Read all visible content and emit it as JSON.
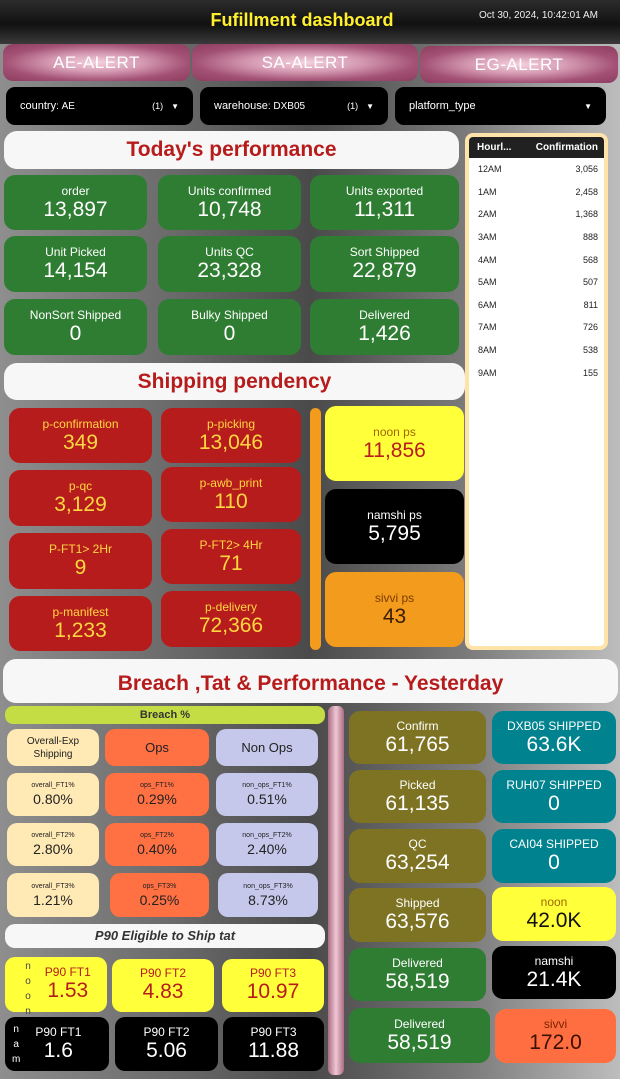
{
  "header": {
    "title": "Fufillment dashboard",
    "timestamp": "Oct 30, 2024, 10:42:01 AM"
  },
  "alerts": [
    "AE-ALERT",
    "SA-ALERT",
    "EG-ALERT"
  ],
  "filters": [
    {
      "key": "country",
      "value": "AE",
      "count": "(1)"
    },
    {
      "key": "warehouse",
      "value": "DXB05",
      "count": "(1)"
    },
    {
      "key": "platform_type",
      "value": "",
      "count": ""
    }
  ],
  "sections": {
    "today": "Today's performance",
    "shipping": "Shipping pendency",
    "breach": "Breach ,Tat & Performance - Yesterday"
  },
  "today": [
    {
      "label": "order",
      "value": "13,897"
    },
    {
      "label": "Units confirmed",
      "value": "10,748"
    },
    {
      "label": "Units exported",
      "value": "11,311"
    },
    {
      "label": "Unit Picked",
      "value": "14,154"
    },
    {
      "label": "Units QC",
      "value": "23,328"
    },
    {
      "label": "Sort Shipped",
      "value": "22,879"
    },
    {
      "label": "NonSort Shipped",
      "value": "0"
    },
    {
      "label": "Bulky Shipped",
      "value": "0"
    },
    {
      "label": "Delivered",
      "value": "1,426"
    }
  ],
  "pendency": [
    {
      "label": "p-confirmation",
      "value": "349"
    },
    {
      "label": "p-picking",
      "value": "13,046"
    },
    {
      "label": "p-qc",
      "value": "3,129"
    },
    {
      "label": "p-awb_print",
      "value": "110"
    },
    {
      "label": "P-FT1> 2Hr",
      "value": "9"
    },
    {
      "label": "P-FT2> 4Hr",
      "value": "71"
    },
    {
      "label": "p-manifest",
      "value": "1,233"
    },
    {
      "label": "p-delivery",
      "value": "72,366"
    }
  ],
  "platform_ps": [
    {
      "label": "noon ps",
      "value": "11,856"
    },
    {
      "label": "namshi ps",
      "value": "5,795"
    },
    {
      "label": "sivvi ps",
      "value": "43"
    }
  ],
  "hourly": {
    "headers": [
      "Hourl...",
      "Confirmation"
    ],
    "rows": [
      [
        "12AM",
        "3,056"
      ],
      [
        "1AM",
        "2,458"
      ],
      [
        "2AM",
        "1,368"
      ],
      [
        "3AM",
        "888"
      ],
      [
        "4AM",
        "568"
      ],
      [
        "5AM",
        "507"
      ],
      [
        "6AM",
        "811"
      ],
      [
        "7AM",
        "726"
      ],
      [
        "8AM",
        "538"
      ],
      [
        "9AM",
        "155"
      ]
    ]
  },
  "breach": {
    "title": "Breach %",
    "headers": [
      "Overall-Exp Shipping",
      "Ops",
      "Non Ops"
    ],
    "rows": [
      [
        {
          "label": "overall_FT1%",
          "value": "0.80%"
        },
        {
          "label": "ops_FT1%",
          "value": "0.29%"
        },
        {
          "label": "non_ops_FT1%",
          "value": "0.51%"
        }
      ],
      [
        {
          "label": "overall_FT2%",
          "value": "2.80%"
        },
        {
          "label": "ops_FT2%",
          "value": "0.40%"
        },
        {
          "label": "non_ops_FT2%",
          "value": "2.40%"
        }
      ],
      [
        {
          "label": "overall_FT3%",
          "value": "1.21%"
        },
        {
          "label": "ops_FT3%",
          "value": "0.25%"
        },
        {
          "label": "non_ops_FT3%",
          "value": "8.73%"
        }
      ]
    ]
  },
  "p90": {
    "title": "P90 Eligible to Ship tat",
    "noon_label": [
      "n",
      "o",
      "o",
      "n"
    ],
    "nam_label": [
      "n",
      "a",
      "m"
    ],
    "noon": [
      {
        "label": "P90 FT1",
        "value": "1.53"
      },
      {
        "label": "P90 FT2",
        "value": "4.83"
      },
      {
        "label": "P90 FT3",
        "value": "10.97"
      }
    ],
    "nam": [
      {
        "label": "P90 FT1",
        "value": "1.6"
      },
      {
        "label": "P90 FT2",
        "value": "5.06"
      },
      {
        "label": "P90 FT3",
        "value": "11.88"
      }
    ]
  },
  "yesterday_flow": [
    {
      "label": "Confirm",
      "value": "61,765"
    },
    {
      "label": "Picked",
      "value": "61,135"
    },
    {
      "label": "QC",
      "value": "63,254"
    },
    {
      "label": "Shipped",
      "value": "63,576"
    },
    {
      "label": "Delivered",
      "value": "58,519"
    },
    {
      "label": "Delivered",
      "value": "58,519"
    }
  ],
  "yesterday_ship": [
    {
      "label": "DXB05 SHIPPED",
      "value": "63.6K"
    },
    {
      "label": "RUH07 SHIPPED",
      "value": "0"
    },
    {
      "label": "CAI04 SHIPPED",
      "value": "0"
    },
    {
      "label": "noon",
      "value": "42.0K"
    },
    {
      "label": "namshi",
      "value": "21.4K"
    },
    {
      "label": "sivvi",
      "value": "172.0"
    }
  ],
  "colors": {
    "green": "#2e7d32",
    "red": "#b71c1c",
    "yellow": "#ffff3a",
    "olive": "#7d7322",
    "teal": "#00838f",
    "orange": "#f29b1c",
    "salmon": "#ff6e40"
  }
}
